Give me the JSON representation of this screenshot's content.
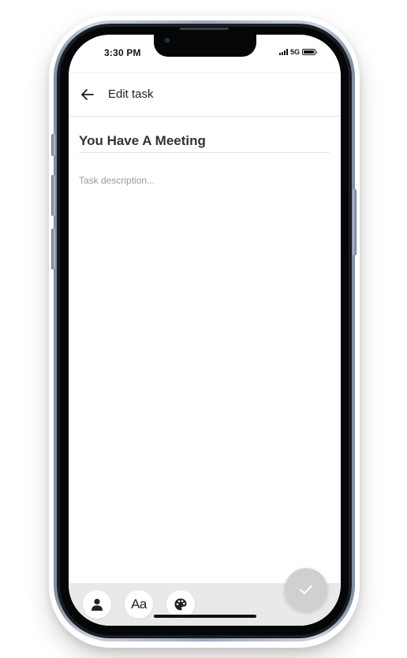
{
  "status_bar": {
    "time": "3:30 PM",
    "network": "5G",
    "icons": [
      "signal-icon",
      "battery-icon"
    ]
  },
  "app_bar": {
    "back_icon": "arrow-left-icon",
    "title": "Edit task"
  },
  "task": {
    "title": "You Have A Meeting",
    "description_value": "",
    "description_placeholder": "Task description..."
  },
  "toolbar": {
    "items": [
      {
        "icon": "person-icon"
      },
      {
        "icon": "text-format-icon",
        "label": "Aa"
      },
      {
        "icon": "palette-icon"
      }
    ]
  },
  "fab": {
    "icon": "check-icon"
  },
  "colors": {
    "fab_background": "#d0d0d0",
    "toolbar_background": "#e9e9e9",
    "text_primary": "#222222"
  }
}
